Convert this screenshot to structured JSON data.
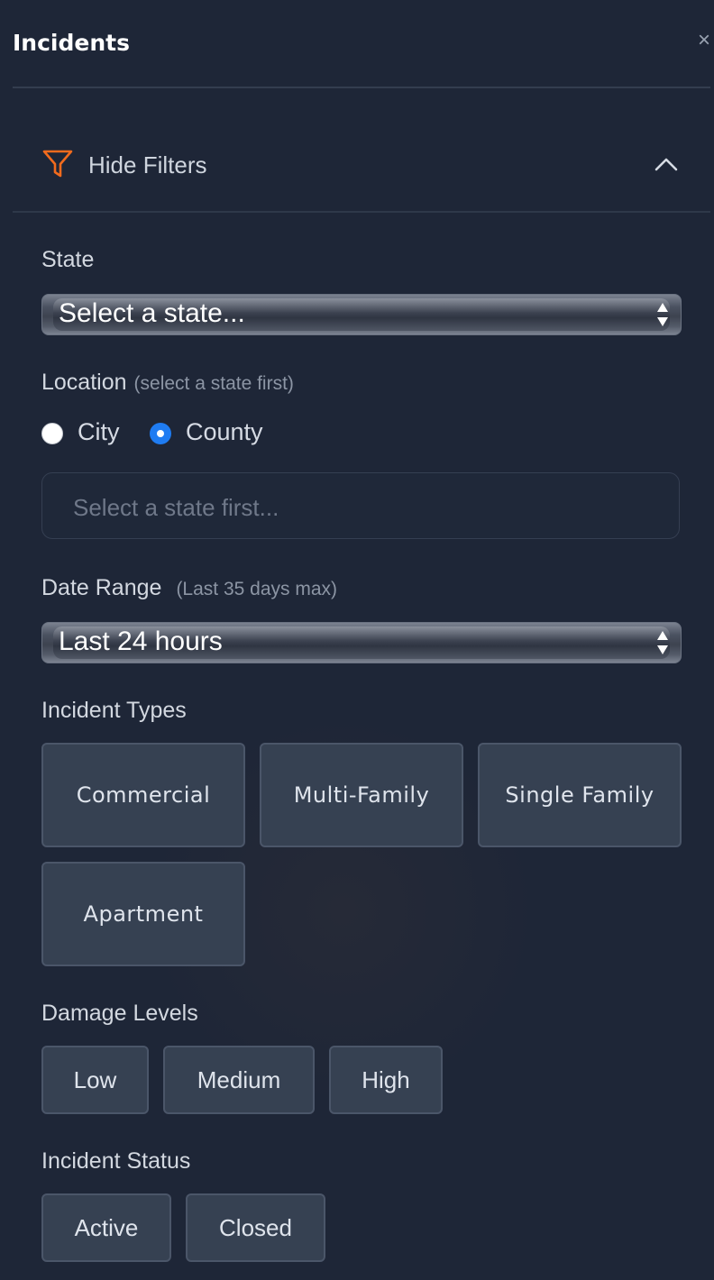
{
  "header": {
    "title": "Incidents",
    "close_label": "×"
  },
  "filters_toggle": {
    "label": "Hide Filters",
    "icon": "funnel-icon",
    "icon_color": "#f26b1d"
  },
  "state": {
    "label": "State",
    "selected": "Select a state..."
  },
  "location": {
    "label": "Location",
    "hint": "(select a state first)",
    "options": [
      {
        "label": "City",
        "checked": false
      },
      {
        "label": "County",
        "checked": true
      }
    ],
    "input_placeholder": "Select a state first..."
  },
  "date_range": {
    "label": "Date Range",
    "hint": "(Last 35 days max)",
    "selected": "Last 24 hours"
  },
  "incident_types": {
    "label": "Incident Types",
    "items": [
      "Commercial",
      "Multi-Family",
      "Single Family",
      "Apartment"
    ]
  },
  "damage_levels": {
    "label": "Damage Levels",
    "items": [
      "Low",
      "Medium",
      "High"
    ]
  },
  "incident_status": {
    "label": "Incident Status",
    "items": [
      "Active",
      "Closed"
    ]
  },
  "colors": {
    "background": "#1e2637",
    "chip_background": "#364152",
    "accent_radio": "#1f7cf2",
    "filter_icon": "#f26b1d"
  }
}
